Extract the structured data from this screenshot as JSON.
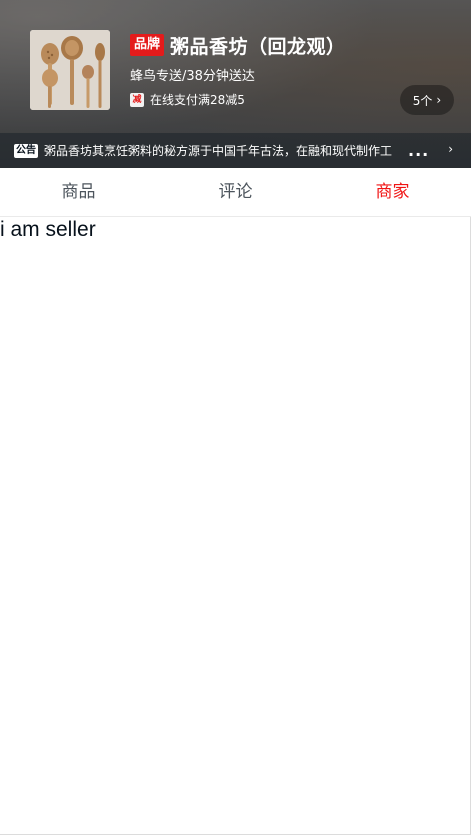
{
  "header": {
    "brand_badge": "品牌",
    "shop_name": "粥品香坊（回龙观）",
    "delivery": "蜂鸟专送/38分钟送达",
    "support_icon_text": "减",
    "support_text": "在线支付满28减5",
    "support_count": "5个",
    "avatar_icon": "wooden-spoons-image"
  },
  "bulletin": {
    "tag": "公告",
    "text": "粥品香坊其烹饪粥料的秘方源于中国千年古法，在融和现代制作工",
    "ellipsis": "..."
  },
  "tabs": [
    {
      "label": "商品",
      "active": false
    },
    {
      "label": "评论",
      "active": false
    },
    {
      "label": "商家",
      "active": true
    }
  ],
  "content": {
    "text": "i am seller"
  },
  "colors": {
    "accent": "#f01414",
    "brand_badge": "#e41b1b",
    "tab_text": "#4d555d"
  }
}
